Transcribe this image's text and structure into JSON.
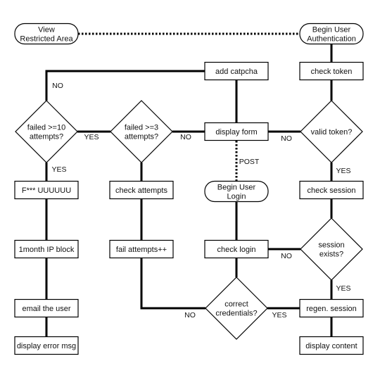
{
  "diagram": {
    "type": "flowchart",
    "colors": {
      "stroke": "#000000",
      "fill": "#ffffff",
      "text": "#111111"
    },
    "nodes": [
      {
        "id": "view_restricted",
        "shape": "terminal",
        "lines": [
          "View",
          "Restricted Area"
        ]
      },
      {
        "id": "begin_auth",
        "shape": "terminal",
        "lines": [
          "Begin User",
          "Authentication"
        ]
      },
      {
        "id": "add_captcha",
        "shape": "process",
        "lines": [
          "add catpcha"
        ]
      },
      {
        "id": "check_token",
        "shape": "process",
        "lines": [
          "check token"
        ]
      },
      {
        "id": "failed10",
        "shape": "decision",
        "lines": [
          "failed >=10",
          "attempts?"
        ]
      },
      {
        "id": "failed3",
        "shape": "decision",
        "lines": [
          "failed >=3",
          "attempts?"
        ]
      },
      {
        "id": "display_form",
        "shape": "process",
        "lines": [
          "display form"
        ]
      },
      {
        "id": "valid_token",
        "shape": "decision",
        "lines": [
          "valid token?"
        ]
      },
      {
        "id": "fuuu",
        "shape": "process",
        "lines": [
          "F*** UUUUUU"
        ]
      },
      {
        "id": "check_attempts",
        "shape": "process",
        "lines": [
          "check attempts"
        ]
      },
      {
        "id": "begin_login",
        "shape": "terminal",
        "lines": [
          "Begin User",
          "Login"
        ]
      },
      {
        "id": "check_session",
        "shape": "process",
        "lines": [
          "check session"
        ]
      },
      {
        "id": "ip_block",
        "shape": "process",
        "lines": [
          "1month IP block"
        ]
      },
      {
        "id": "fail_attempts",
        "shape": "process",
        "lines": [
          "fail attempts++"
        ]
      },
      {
        "id": "check_login",
        "shape": "process",
        "lines": [
          "check login"
        ]
      },
      {
        "id": "session_exists",
        "shape": "decision",
        "lines": [
          "session",
          "exists?"
        ]
      },
      {
        "id": "email_user",
        "shape": "process",
        "lines": [
          "email the user"
        ]
      },
      {
        "id": "correct_creds",
        "shape": "decision",
        "lines": [
          "correct",
          "credentials?"
        ]
      },
      {
        "id": "regen_session",
        "shape": "process",
        "lines": [
          "regen. session"
        ]
      },
      {
        "id": "display_error",
        "shape": "process",
        "lines": [
          "display error msg"
        ]
      },
      {
        "id": "display_content",
        "shape": "process",
        "lines": [
          "display content"
        ]
      }
    ],
    "edges": [
      {
        "from": "view_restricted",
        "to": "begin_auth",
        "style": "dotted",
        "label": ""
      },
      {
        "from": "begin_auth",
        "to": "check_token",
        "style": "solid",
        "label": ""
      },
      {
        "from": "check_token",
        "to": "valid_token",
        "style": "solid",
        "label": ""
      },
      {
        "from": "valid_token",
        "to": "display_form",
        "style": "solid",
        "label": "NO"
      },
      {
        "from": "valid_token",
        "to": "check_session",
        "style": "solid",
        "label": "YES"
      },
      {
        "from": "check_session",
        "to": "session_exists",
        "style": "solid",
        "label": ""
      },
      {
        "from": "session_exists",
        "to": "check_login",
        "style": "solid",
        "label": "NO"
      },
      {
        "from": "session_exists",
        "to": "regen_session",
        "style": "solid",
        "label": "YES"
      },
      {
        "from": "regen_session",
        "to": "display_content",
        "style": "solid",
        "label": ""
      },
      {
        "from": "add_captcha",
        "to": "display_form",
        "style": "solid",
        "label": ""
      },
      {
        "from": "display_form",
        "to": "begin_login",
        "style": "dotted",
        "label": "POST"
      },
      {
        "from": "begin_login",
        "to": "check_login",
        "style": "solid",
        "label": ""
      },
      {
        "from": "check_login",
        "to": "correct_creds",
        "style": "solid",
        "label": ""
      },
      {
        "from": "correct_creds",
        "to": "regen_session",
        "style": "solid",
        "label": "YES"
      },
      {
        "from": "correct_creds",
        "to": "fail_attempts",
        "style": "solid",
        "label": "NO"
      },
      {
        "from": "fail_attempts",
        "to": "check_attempts",
        "style": "solid",
        "label": ""
      },
      {
        "from": "check_attempts",
        "to": "failed3",
        "style": "solid",
        "label": ""
      },
      {
        "from": "failed3",
        "to": "display_form",
        "style": "solid",
        "label": "NO"
      },
      {
        "from": "failed3",
        "to": "failed10",
        "style": "solid",
        "label": "YES"
      },
      {
        "from": "failed10",
        "to": "add_captcha",
        "style": "solid",
        "label": "NO"
      },
      {
        "from": "failed10",
        "to": "fuuu",
        "style": "solid",
        "label": "YES"
      },
      {
        "from": "fuuu",
        "to": "ip_block",
        "style": "solid",
        "label": ""
      },
      {
        "from": "ip_block",
        "to": "email_user",
        "style": "solid",
        "label": ""
      },
      {
        "from": "email_user",
        "to": "display_error",
        "style": "solid",
        "label": ""
      }
    ]
  }
}
